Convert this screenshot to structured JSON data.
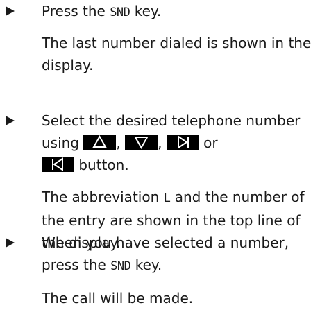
{
  "steps": [
    {
      "pre": "Press the ",
      "key": "SND",
      "post": " key.",
      "result_lines": [
        "The last number dialed is shown in the",
        "display."
      ]
    },
    {
      "line1": "Select the desired telephone number",
      "line2_pre": "using ",
      "sep1": ", ",
      "sep2": ", ",
      "line2_post": " or",
      "line3_post": " button.",
      "buttons": [
        "up-arrow-icon",
        "down-arrow-icon",
        "skip-forward-icon",
        "skip-back-icon"
      ],
      "result_line1_pre": "The abbreviation ",
      "result_abbrev": "L",
      "result_line1_post": " and the number of",
      "result_line2": "the entry are shown in the top line of",
      "result_line3": "the display."
    },
    {
      "line1": "When you have selected a number,",
      "line2_pre": "press the ",
      "key": "SND",
      "line2_post": " key.",
      "result": "The call will be made."
    }
  ]
}
